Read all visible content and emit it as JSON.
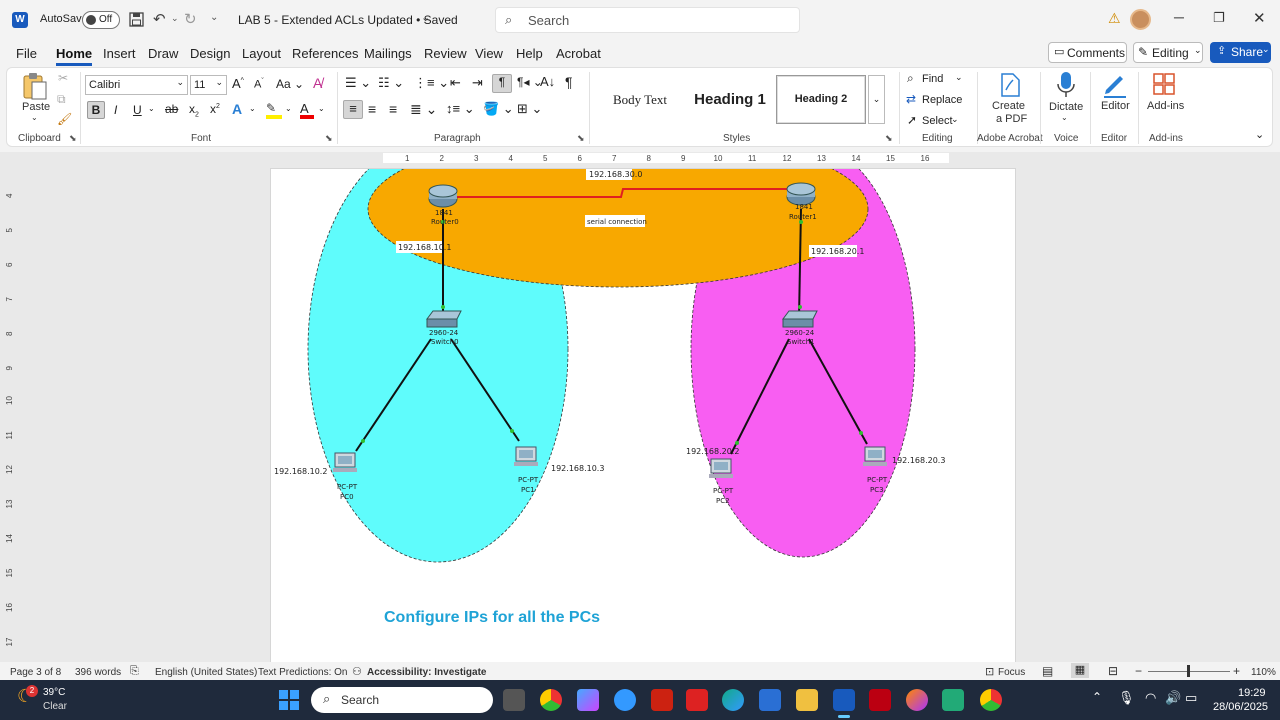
{
  "titlebar": {
    "autosave_label": "AutoSave",
    "autosave_state": "Off",
    "doc_title": "LAB 5 - Extended ACLs Updated • Saved",
    "search_placeholder": "Search"
  },
  "menu": {
    "tabs": [
      "File",
      "Home",
      "Insert",
      "Draw",
      "Design",
      "Layout",
      "References",
      "Mailings",
      "Review",
      "View",
      "Help",
      "Acrobat"
    ],
    "active": "Home",
    "comments": "Comments",
    "editing": "Editing",
    "share": "Share"
  },
  "ribbon": {
    "clipboard": {
      "paste": "Paste",
      "group": "Clipboard"
    },
    "font": {
      "name": "Calibri",
      "size": "11",
      "group": "Font",
      "bold": "B",
      "italic": "I",
      "underline": "U"
    },
    "paragraph": {
      "group": "Paragraph"
    },
    "styles": {
      "group": "Styles",
      "items": [
        "Body Text",
        "Heading 1",
        "Heading 2"
      ]
    },
    "editing": {
      "group": "Editing",
      "find": "Find",
      "replace": "Replace",
      "select": "Select"
    },
    "acrobat": {
      "label1": "Create",
      "label2": "a PDF",
      "group": "Adobe Acrobat"
    },
    "voice": {
      "label": "Dictate",
      "group": "Voice"
    },
    "editor": {
      "label": "Editor",
      "group": "Editor"
    },
    "addins": {
      "label": "Add-ins",
      "group": "Add-ins"
    }
  },
  "ruler": {
    "numbers": [
      "1",
      "2",
      "3",
      "4",
      "5",
      "6",
      "7",
      "8",
      "9",
      "10",
      "11",
      "12",
      "13",
      "14",
      "15",
      "16"
    ],
    "vnumbers": [
      "4",
      "5",
      "6",
      "7",
      "8",
      "9",
      "10",
      "11",
      "12",
      "13",
      "14",
      "15",
      "16",
      "17"
    ]
  },
  "diagram": {
    "serial_net": "192.168.30.0",
    "serial_label": "serial connection",
    "router0": {
      "model": "1841",
      "name": "Router0",
      "ip": "192.168.10.1"
    },
    "router1": {
      "model": "1841",
      "name": "Router1",
      "ip": "192.168.20.1"
    },
    "switch0": {
      "model": "2960-24",
      "name": "Switch0"
    },
    "switch1": {
      "model": "2960-24",
      "name": "Switch1"
    },
    "pc0": {
      "type": "PC-PT",
      "name": "PC0",
      "ip": "192.168.10.2"
    },
    "pc1": {
      "type": "PC-PT",
      "name": "PC1",
      "ip": "192.168.10.3"
    },
    "pc2": {
      "type": "PC-PT",
      "name": "PC2",
      "ip": "192.168.20.2"
    },
    "pc3": {
      "type": "PC-PT",
      "name": "PC3",
      "ip": "192.168.20.3"
    },
    "colors": {
      "lan1": "#5ffcfc",
      "lan2": "#f85ef2",
      "wan": "#f8a800",
      "serial": "#e02020"
    }
  },
  "heading": "Configure IPs for all the PCs",
  "status": {
    "page": "Page 3 of 8",
    "words": "396 words",
    "language": "English (United States)",
    "predictions": "Text Predictions: On",
    "accessibility": "Accessibility: Investigate",
    "focus": "Focus",
    "zoom": "110%"
  },
  "taskbar": {
    "temp": "39°C",
    "weather": "Clear",
    "badge": "2",
    "search": "Search",
    "time": "19:29",
    "date": "28/06/2025"
  }
}
